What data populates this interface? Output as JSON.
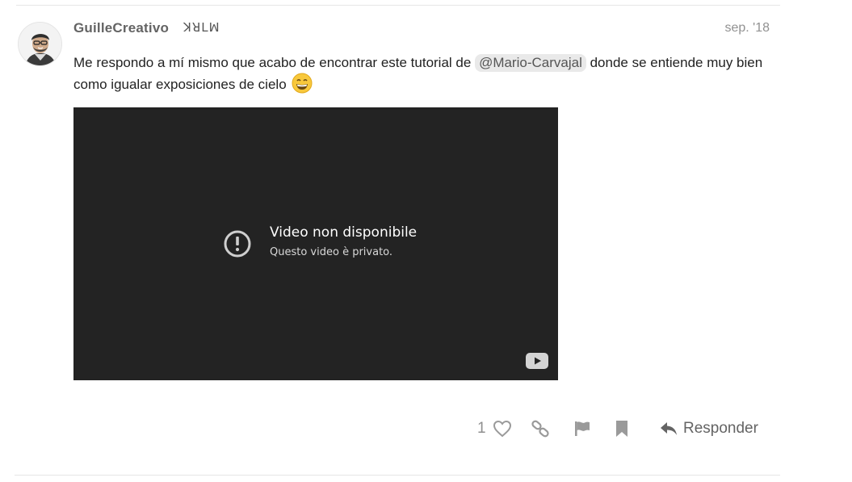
{
  "post": {
    "author": {
      "username": "GuilleCreativo",
      "flair": "ꓘꓤꓡꟽ"
    },
    "date": "sep. '18",
    "body": {
      "text_before_mention": "Me respondo a mí mismo que acabo de encontrar este tutorial de ",
      "mention": "@Mario-Carvajal",
      "text_after_mention": " donde se entiende muy bien como igualar exposiciones de cielo",
      "emoji": "grinning-face-emoji"
    },
    "video": {
      "title": "Video non disponibile",
      "subtitle": "Questo video è privato.",
      "icons": [
        "exclamation-circle-icon",
        "youtube-icon"
      ]
    },
    "actions": {
      "like_count": "1",
      "reply_label": "Responder",
      "icons": [
        "heart-icon",
        "link-icon",
        "flag-icon",
        "bookmark-icon",
        "reply-icon"
      ]
    }
  }
}
